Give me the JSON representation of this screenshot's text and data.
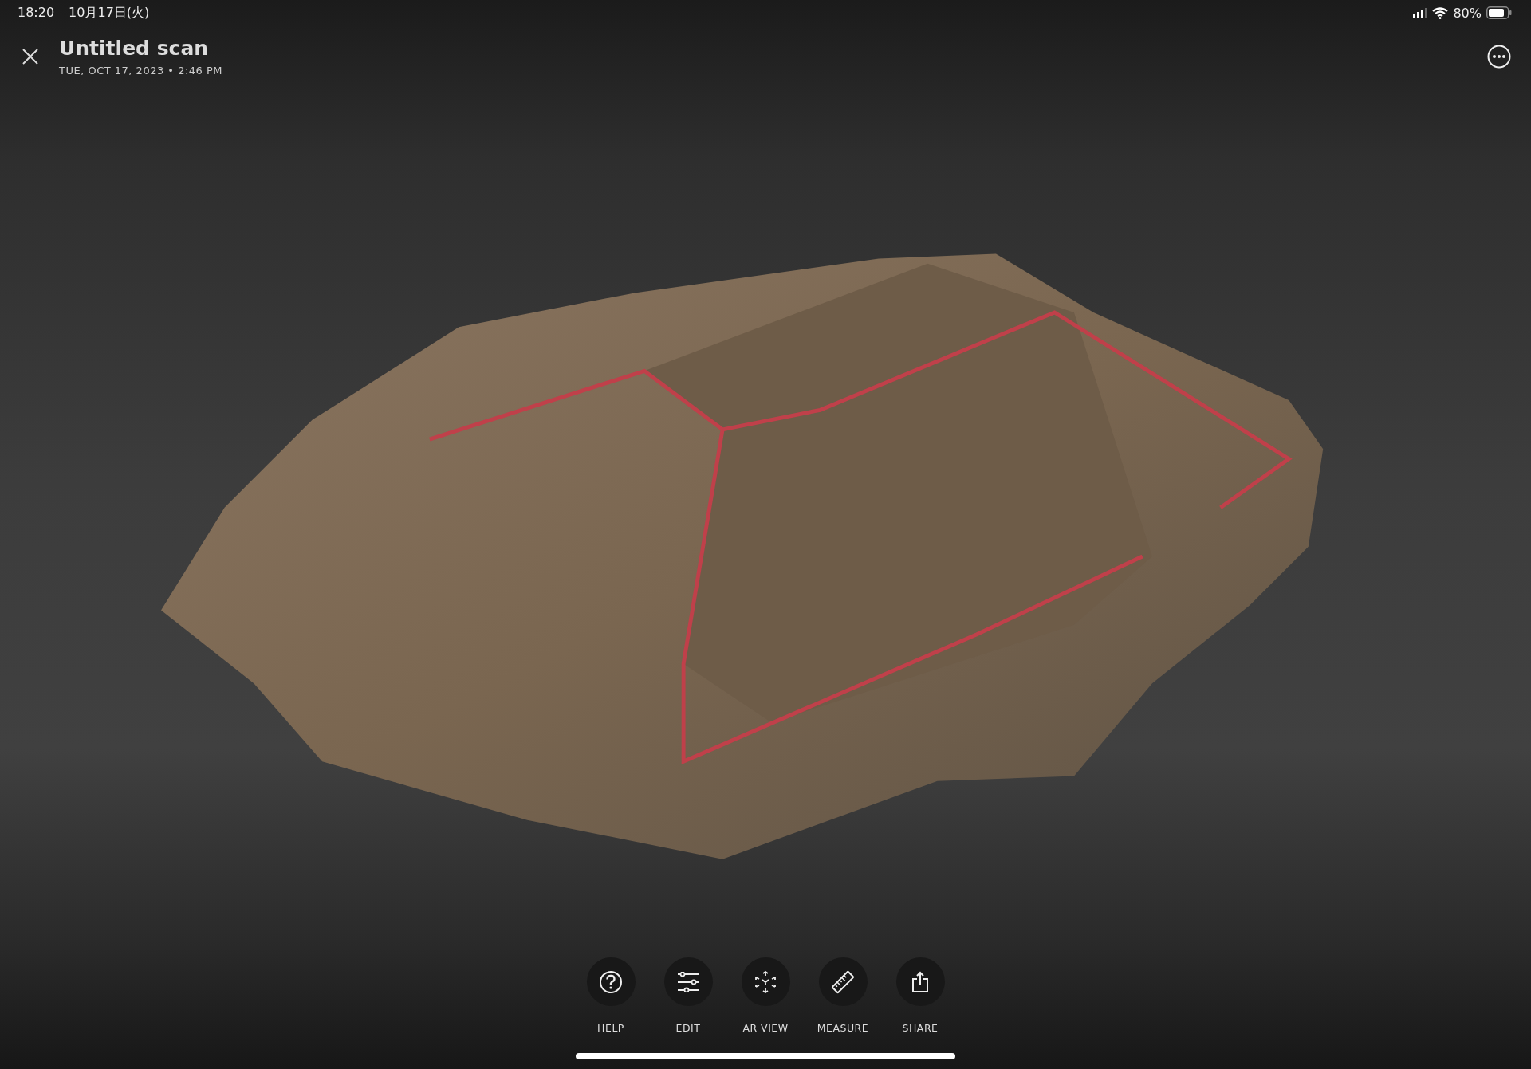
{
  "status_bar": {
    "time": "18:20",
    "date": "10月17日(火)",
    "battery": "80%"
  },
  "header": {
    "title": "Untitled scan",
    "subtitle": "TUE, OCT 17, 2023 • 2:46 PM"
  },
  "toolbar": [
    {
      "kind": "help",
      "label": "HELP"
    },
    {
      "kind": "edit",
      "label": "EDIT"
    },
    {
      "kind": "ar",
      "label": "AR VIEW"
    },
    {
      "kind": "measure",
      "label": "MEASURE"
    },
    {
      "kind": "share",
      "label": "SHARE"
    }
  ]
}
